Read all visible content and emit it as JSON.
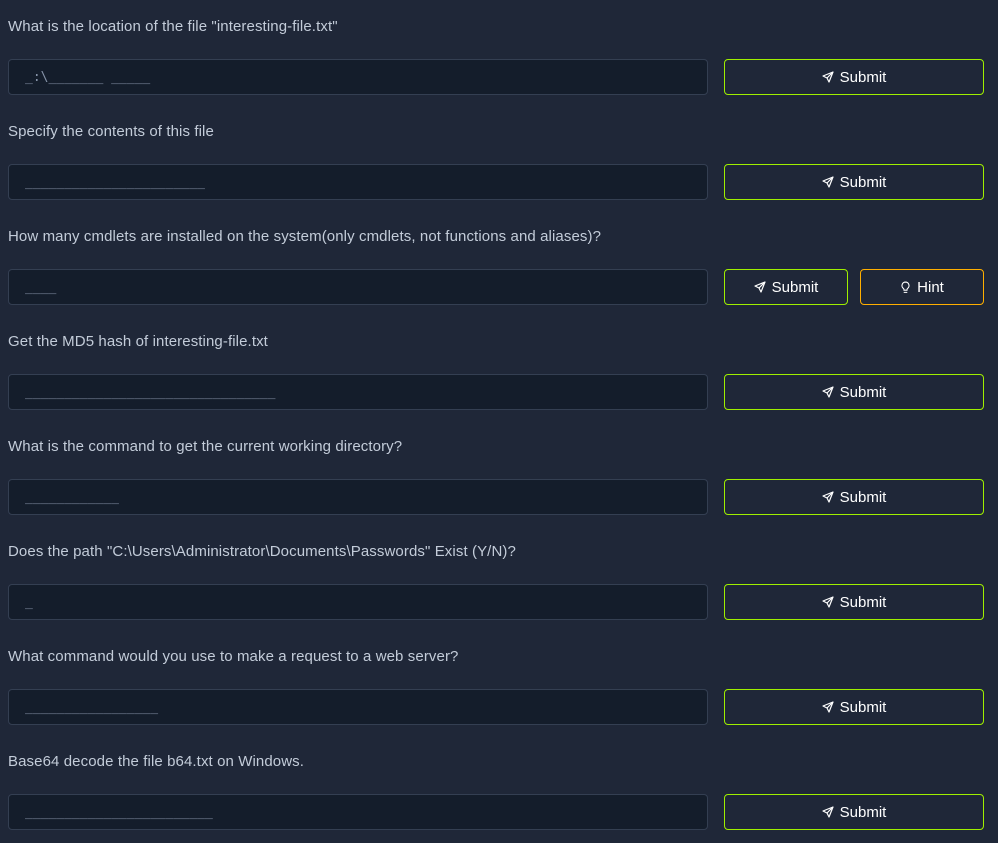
{
  "accent_colors": {
    "submit_border": "#9fef00",
    "hint_border": "#ffaf00",
    "page_background": "#1f2738",
    "input_background": "#141d2b"
  },
  "icons": {
    "submit": "paper-plane-icon",
    "hint": "lightbulb-icon"
  },
  "questions": [
    {
      "text": "What is the location of the file \"interesting-file.txt\"",
      "placeholder": "_:\\_______ _____",
      "value": "",
      "submit_label": "Submit"
    },
    {
      "text": "Specify the contents of this file",
      "placeholder": "_______________________",
      "value": "",
      "submit_label": "Submit"
    },
    {
      "text": "How many cmdlets are installed on the system(only cmdlets, not functions and aliases)?",
      "placeholder": "____",
      "value": "",
      "submit_label": "Submit",
      "hint_label": "Hint"
    },
    {
      "text": "Get the MD5 hash of interesting-file.txt",
      "placeholder": "________________________________",
      "value": "",
      "submit_label": "Submit"
    },
    {
      "text": "What is the command to get the current working directory?",
      "placeholder": "____________",
      "value": "",
      "submit_label": "Submit"
    },
    {
      "text": "Does the path \"C:\\Users\\Administrator\\Documents\\Passwords\" Exist (Y/N)?",
      "placeholder": "_",
      "value": "",
      "submit_label": "Submit"
    },
    {
      "text": "What command would you use to make a request to a web server?",
      "placeholder": "_________________",
      "value": "",
      "submit_label": "Submit"
    },
    {
      "text": "Base64 decode the file b64.txt on Windows.",
      "placeholder": "________________________",
      "value": "",
      "submit_label": "Submit"
    }
  ]
}
